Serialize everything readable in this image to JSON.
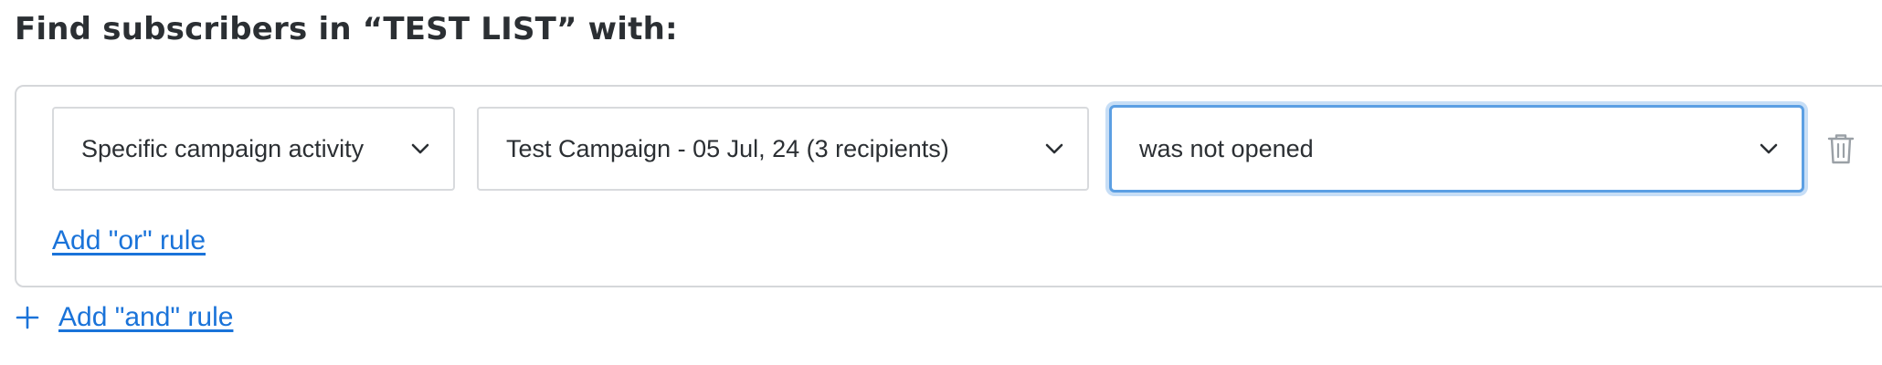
{
  "heading": "Find subscribers in “TEST LIST” with:",
  "rule": {
    "condition_type": "Specific campaign activity",
    "campaign": "Test Campaign - 05 Jul, 24 (3 recipients)",
    "activity": "was not opened",
    "icons": {
      "dropdown": "chevron-down-icon",
      "delete": "trash-icon"
    }
  },
  "actions": {
    "add_or_rule": "Add \"or\" rule",
    "add_and_rule": "Add \"and\" rule",
    "add_and_icon": "plus-icon"
  },
  "colors": {
    "link": "#1a73d9",
    "focus_border": "#5b9fe3",
    "border": "#d8dadd",
    "text": "#2b2f33"
  }
}
